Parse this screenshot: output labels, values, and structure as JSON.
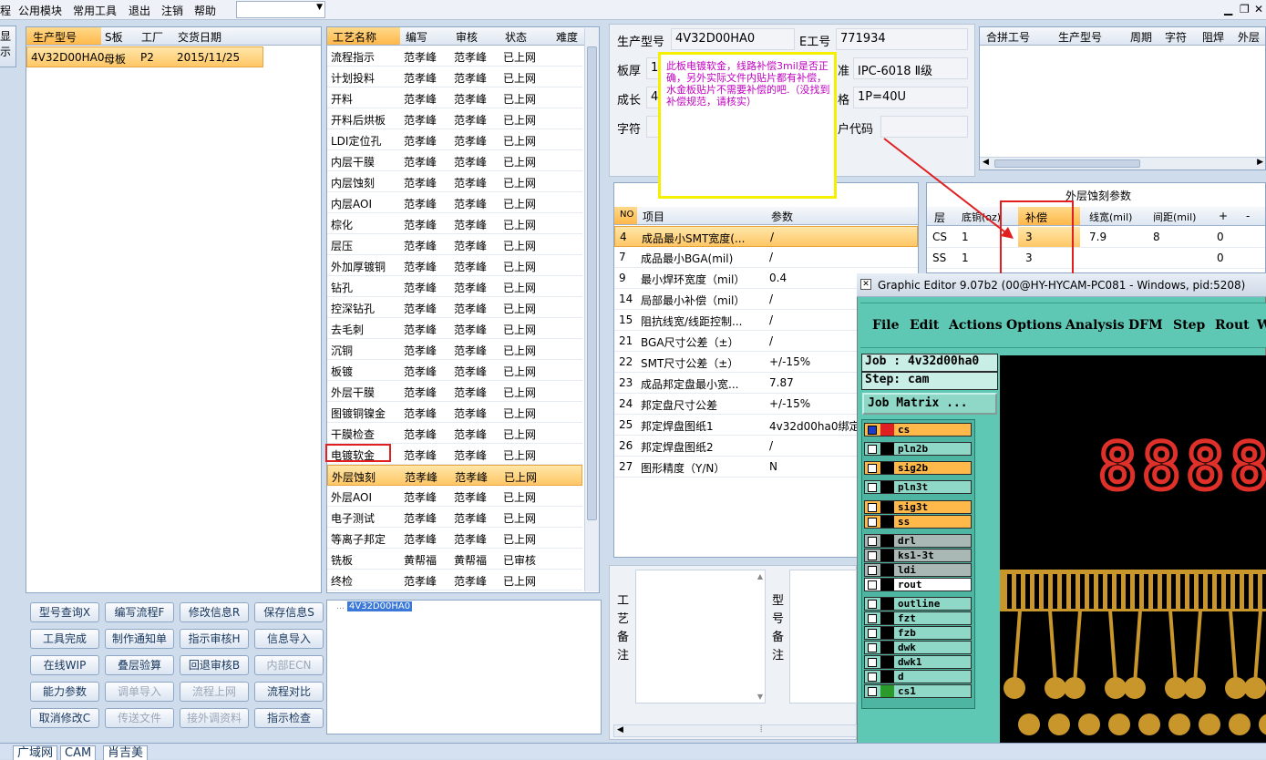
{
  "menubar": {
    "items": [
      "程",
      "公用模块",
      "常用工具",
      "退出",
      "注销",
      "帮助"
    ]
  },
  "left_edge": {
    "label1": "显",
    "label2": "示"
  },
  "model_table": {
    "headers": [
      "生产型号",
      "S板",
      "工厂",
      "交货日期"
    ],
    "row": [
      "4V32D00HA0",
      "母板",
      "P2",
      "2015/11/25"
    ]
  },
  "process_table": {
    "headers": [
      "工艺名称",
      "编写",
      "审核",
      "状态",
      "难度"
    ],
    "rows": [
      [
        "流程指示",
        "范孝峰",
        "范孝峰",
        "已上网"
      ],
      [
        "计划投料",
        "范孝峰",
        "范孝峰",
        "已上网"
      ],
      [
        "开料",
        "范孝峰",
        "范孝峰",
        "已上网"
      ],
      [
        "开料后烘板",
        "范孝峰",
        "范孝峰",
        "已上网"
      ],
      [
        "LDI定位孔",
        "范孝峰",
        "范孝峰",
        "已上网"
      ],
      [
        "内层干膜",
        "范孝峰",
        "范孝峰",
        "已上网"
      ],
      [
        "内层蚀刻",
        "范孝峰",
        "范孝峰",
        "已上网"
      ],
      [
        "内层AOI",
        "范孝峰",
        "范孝峰",
        "已上网"
      ],
      [
        "棕化",
        "范孝峰",
        "范孝峰",
        "已上网"
      ],
      [
        "层压",
        "范孝峰",
        "范孝峰",
        "已上网"
      ],
      [
        "外加厚镀铜",
        "范孝峰",
        "范孝峰",
        "已上网"
      ],
      [
        "钻孔",
        "范孝峰",
        "范孝峰",
        "已上网"
      ],
      [
        "控深钻孔",
        "范孝峰",
        "范孝峰",
        "已上网"
      ],
      [
        "去毛刺",
        "范孝峰",
        "范孝峰",
        "已上网"
      ],
      [
        "沉铜",
        "范孝峰",
        "范孝峰",
        "已上网"
      ],
      [
        "板镀",
        "范孝峰",
        "范孝峰",
        "已上网"
      ],
      [
        "外层干膜",
        "范孝峰",
        "范孝峰",
        "已上网"
      ],
      [
        "图镀铜镍金",
        "范孝峰",
        "范孝峰",
        "已上网"
      ],
      [
        "干膜检查",
        "范孝峰",
        "范孝峰",
        "已上网"
      ],
      [
        "电镀软金",
        "范孝峰",
        "范孝峰",
        "已上网"
      ],
      [
        "外层蚀刻",
        "范孝峰",
        "范孝峰",
        "已上网"
      ],
      [
        "外层AOI",
        "范孝峰",
        "范孝峰",
        "已上网"
      ],
      [
        "电子测试",
        "范孝峰",
        "范孝峰",
        "已上网"
      ],
      [
        "等离子邦定",
        "范孝峰",
        "范孝峰",
        "已上网"
      ],
      [
        "铣板",
        "黄帮福",
        "黄帮福",
        "已审核"
      ],
      [
        "终检",
        "范孝峰",
        "范孝峰",
        "已上网"
      ]
    ]
  },
  "tree": {
    "node": "4V32D00HA0"
  },
  "buttons": [
    [
      "型号查询X",
      "编写流程F",
      "修改信息R",
      "保存信息S"
    ],
    [
      "工具完成",
      "制作通知单",
      "指示审核H",
      "信息导入"
    ],
    [
      "在线WIP",
      "叠层验算",
      "回退审核B",
      "内部ECN"
    ],
    [
      "能力参数",
      "调单导入",
      "流程上网",
      "流程对比"
    ],
    [
      "取消修改C",
      "传送文件",
      "接外调资料",
      "指示检查"
    ]
  ],
  "disabled_buttons": [
    "内部ECN",
    "调单导入",
    "流程上网",
    "传送文件",
    "接外调资料"
  ],
  "info": {
    "model_label": "生产型号",
    "model_value": "4V32D00HA0",
    "eno_label": "E工号",
    "eno_value": "771934",
    "thick_label": "板厚",
    "thick_value": "1",
    "std_label": "准",
    "std_value": "IPC-6018 Ⅱ级",
    "len_label": "成长",
    "len_value": "4",
    "spec_label": "格",
    "spec_value": "1P=40U",
    "char_label": "字符",
    "cust_label": "户代码",
    "cust_value": ""
  },
  "note": {
    "text": "此板电镀软金，线路补偿3mil是否正确，另外实际文件内贴片都有补偿，水金板贴片不需要补偿的吧.（没找到补偿规范，请核实）"
  },
  "merge_table": {
    "headers": [
      "合拼工号",
      "生产型号",
      "周期",
      "字符",
      "阻焊",
      "外层"
    ]
  },
  "param_table": {
    "headers": [
      "NO",
      "项目",
      "参数"
    ],
    "rows": [
      [
        "4",
        "成品最小SMT宽度(...",
        "/"
      ],
      [
        "7",
        "成品最小BGA(mil)",
        "/"
      ],
      [
        "9",
        "最小焊环宽度（mil）",
        "0.4"
      ],
      [
        "14",
        "局部最小补偿（mil）",
        "/"
      ],
      [
        "15",
        "阻抗线宽/线距控制...",
        "/"
      ],
      [
        "21",
        "BGA尺寸公差（±）",
        "/"
      ],
      [
        "22",
        "SMT尺寸公差（±）",
        "+/-15%"
      ],
      [
        "23",
        "成品邦定盘最小宽...",
        "7.87"
      ],
      [
        "24",
        "邦定盘尺寸公差",
        "+/-15%"
      ],
      [
        "25",
        "邦定焊盘图纸1",
        "4v32d00ha0绑定"
      ],
      [
        "26",
        "邦定焊盘图纸2",
        "/"
      ],
      [
        "27",
        "图形精度（Y/N）",
        "N"
      ]
    ]
  },
  "etch_table": {
    "title": "外层蚀刻参数",
    "headers": [
      "层",
      "底铜(oz)",
      "补偿",
      "线宽(mil)",
      "间距(mil)",
      "+",
      "-"
    ],
    "rows": [
      [
        "CS",
        "1",
        "3",
        "7.9",
        "8",
        "0",
        ""
      ],
      [
        "SS",
        "1",
        "3",
        "",
        "",
        "0",
        ""
      ]
    ]
  },
  "remarks": {
    "process": "工艺备注",
    "model": "型号备注"
  },
  "ge": {
    "title": "Graphic Editor 9.07b2 (00@HY-HYCAM-PC081 - Windows, pid:5208)",
    "menu": [
      "File",
      "Edit",
      "Actions",
      "Options",
      "Analysis",
      "DFM",
      "Step",
      "Rout",
      "W"
    ],
    "job": "Job : 4v32d00ha0",
    "step": "Step: cam",
    "matrix": "Job Matrix ...",
    "layers": [
      "cs",
      "pln2b",
      "sig2b",
      "pln3t",
      "sig3t",
      "ss",
      "drl",
      "ks1-3t",
      "ldi",
      "rout",
      "outline",
      "fzt",
      "fzb",
      "dwk",
      "dwk1",
      "d",
      "cs1"
    ],
    "seg": "8888"
  },
  "taskbar": {
    "tabs": [
      "广域网",
      "CAM",
      "肖吉美"
    ]
  },
  "colors": {
    "accent": "#ffb84a",
    "note_border": "#f5f000",
    "annotation": "#e02020",
    "ge_bg": "#5fc8b4"
  }
}
